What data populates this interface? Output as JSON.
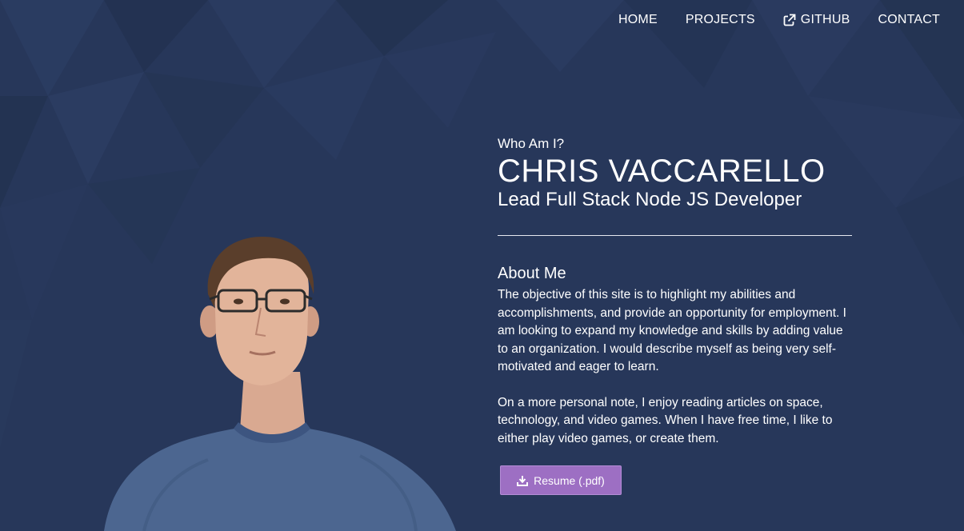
{
  "nav": {
    "items": [
      {
        "label": "HOME",
        "icon": null
      },
      {
        "label": "PROJECTS",
        "icon": null
      },
      {
        "label": "GITHUB",
        "icon": "external-link-icon"
      },
      {
        "label": "CONTACT",
        "icon": null
      }
    ]
  },
  "hero": {
    "kicker": "Who Am I?",
    "name": "CHRIS VACCARELLO",
    "role": "Lead Full Stack Node JS Developer"
  },
  "about": {
    "title": "About Me",
    "paragraphs": [
      "The objective of this site is to highlight my abilities and accomplishments, and provide an opportunity for employment. I am looking to expand my knowledge and skills by adding value to an organization. I would describe myself as being very self-motivated and eager to learn.",
      "On a more personal note, I enjoy reading articles on space, technology, and video games. When I have free time, I like to either play video games, or create them."
    ]
  },
  "resume_button": {
    "label": "Resume (.pdf)",
    "icon": "download-icon"
  },
  "colors": {
    "background": "#27375a",
    "accent": "#9d6fc3",
    "text": "#ffffff"
  }
}
